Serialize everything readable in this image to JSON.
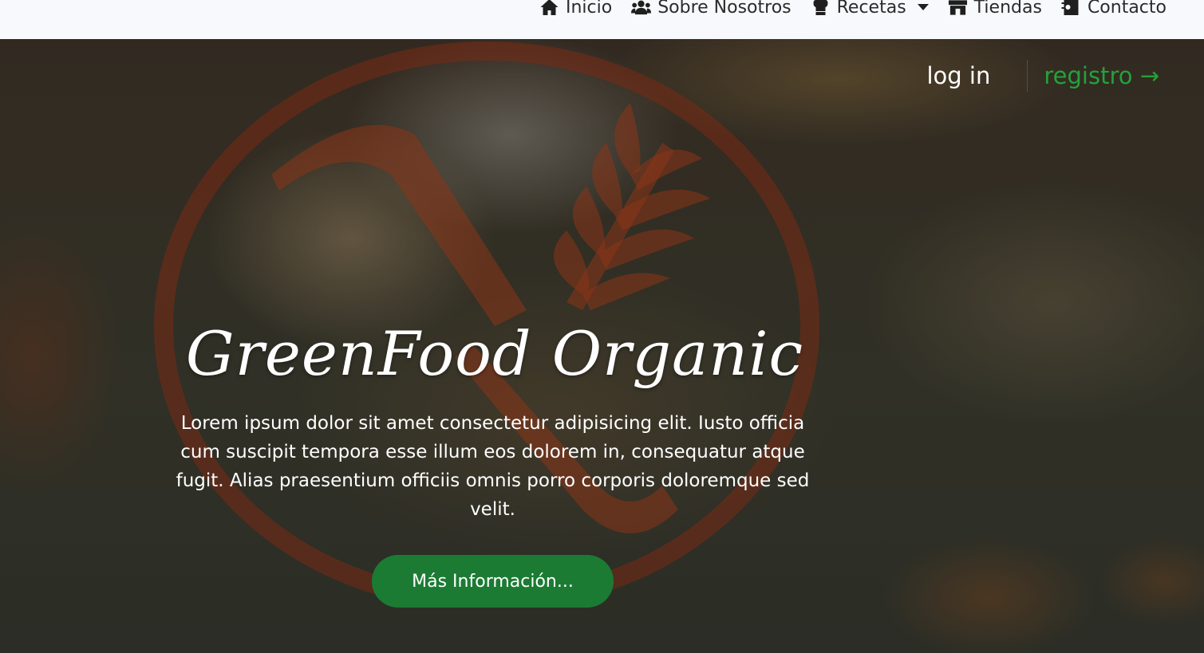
{
  "navbar": {
    "items": [
      {
        "label": "Inicio",
        "icon": "home-icon"
      },
      {
        "label": "Sobre Nosotros",
        "icon": "users-icon"
      },
      {
        "label": "Recetas",
        "icon": "chef-hat-icon"
      },
      {
        "label": "Tiendas",
        "icon": "store-icon"
      },
      {
        "label": "Contacto",
        "icon": "contact-book-icon"
      }
    ]
  },
  "auth": {
    "login": "log in",
    "register": "registro →"
  },
  "hero": {
    "title": "GreenFood Organic",
    "text": "Lorem ipsum dolor sit amet consectetur adipisicing elit. Iusto officia cum suscipit tempora esse illum eos dolorem in, consequatur atque fugit. Alias praesentium officiis omnis porro corporis doloremque sed velit.",
    "button": "Más Información..."
  },
  "colors": {
    "accent": "#25a13a",
    "button": "#1b7b33",
    "logo": "#8b2f17"
  }
}
